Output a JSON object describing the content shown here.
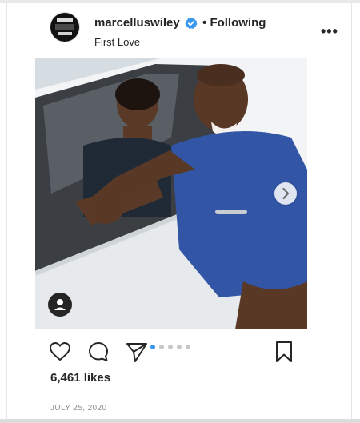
{
  "post": {
    "username": "marcelluswiley",
    "separator": "•",
    "follow_status": "Following",
    "location": "First Love",
    "more_label": "•••",
    "likes": "6,461 likes",
    "date": "JULY 25, 2020",
    "carousel": {
      "total_slides": 5,
      "current_slide": 1
    }
  },
  "colors": {
    "verified_blue": "#3897f0",
    "carousel_active": "#3897f0",
    "carousel_inactive": "#c7c7c7",
    "text": "#262626",
    "muted": "#8e8e8e"
  },
  "icons": {
    "verified": "verified-badge-icon",
    "like": "heart-icon",
    "comment": "comment-icon",
    "share": "share-icon",
    "save": "bookmark-icon",
    "next": "chevron-right-icon",
    "tag": "user-tag-icon",
    "more": "more-options-icon"
  }
}
